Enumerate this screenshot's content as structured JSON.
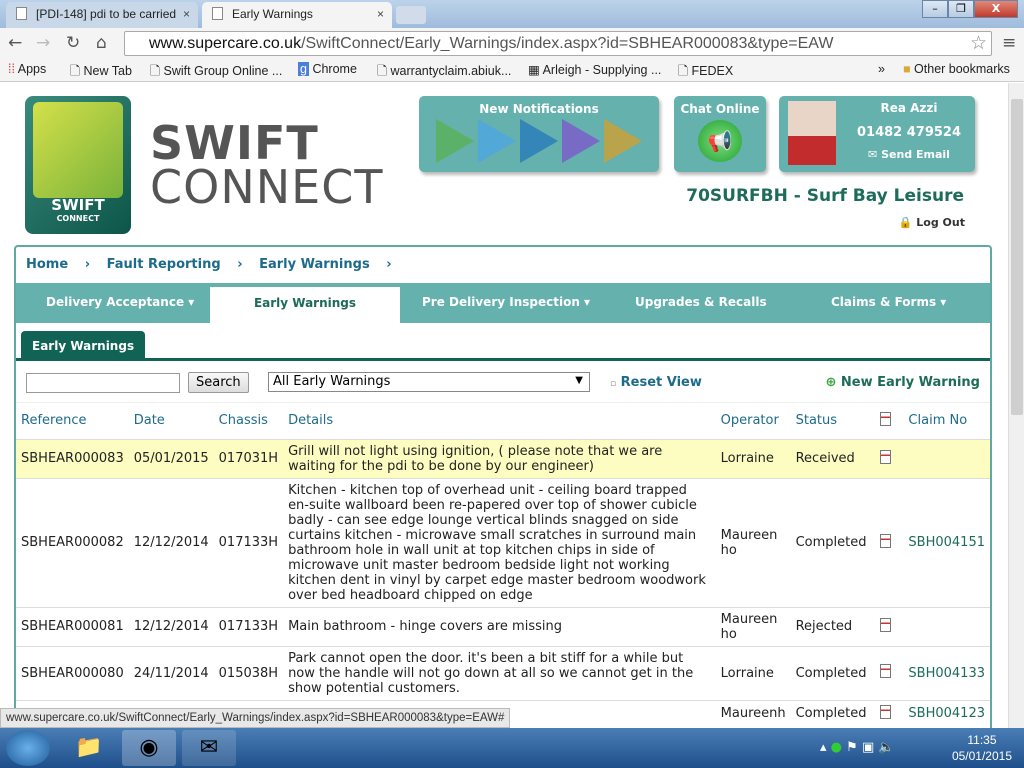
{
  "browser": {
    "tabs": [
      {
        "label": "[PDI-148] pdi to be carried"
      },
      {
        "label": "Early Warnings"
      }
    ],
    "url_host": "www.supercare.co.uk",
    "url_path": "/SwiftConnect/Early_Warnings/index.aspx?id=SBHEAR000083&type=EAW",
    "bookmarks": [
      "Apps",
      "New Tab",
      "Swift Group Online ...",
      "Chrome",
      "warrantyclaim.abiuk...",
      "Arleigh - Supplying ...",
      "FEDEX"
    ],
    "overflow": "»",
    "other_bookmarks": "Other bookmarks",
    "status_url": "www.supercare.co.uk/SwiftConnect/Early_Warnings/index.aspx?id=SBHEAR000083&type=EAW#"
  },
  "header": {
    "logo_text": "SWIFT",
    "logo_sub": "CONNECT",
    "brand_line1": "SWIFT",
    "brand_line2": "CONNECT",
    "notifications_title": "New Notifications",
    "notification_icons": [
      "caravan-icon",
      "laptop-icon",
      "truck-icon",
      "gears-icon",
      "tools-icon"
    ],
    "notification_colors": [
      "#5bb25c",
      "#4fa7dd",
      "#2a7fb8",
      "#7b5fc9",
      "#c9a23a"
    ],
    "chat_label": "Chat Online",
    "contact": {
      "name": "Rea Azzi",
      "phone": "01482 479524",
      "email_label": "Send Email"
    },
    "site_name": "70SURFBH - Surf Bay Leisure",
    "logout": "Log Out"
  },
  "breadcrumb": [
    "Home",
    "Fault Reporting",
    "Early Warnings"
  ],
  "nav": [
    {
      "label": "Delivery Acceptance ▾"
    },
    {
      "label": "Early Warnings"
    },
    {
      "label": "Pre Delivery Inspection ▾"
    },
    {
      "label": "Upgrades & Recalls"
    },
    {
      "label": "Claims & Forms ▾"
    }
  ],
  "subtab": "Early Warnings",
  "filters": {
    "search_value": "",
    "search_button": "Search",
    "select_value": "All Early Warnings",
    "reset": "Reset View",
    "new": "New Early Warning"
  },
  "table": {
    "columns": [
      "Reference",
      "Date",
      "Chassis",
      "Details",
      "Operator",
      "Status",
      "",
      "Claim No"
    ],
    "rows": [
      {
        "ref": "SBHEAR000083",
        "date": "05/01/2015",
        "chassis": "017031H",
        "details": "Grill will not light using ignition, ( please note that we are waiting for the pdi to be done by our engineer)",
        "operator": "Lorraine",
        "status": "Received",
        "claim": ""
      },
      {
        "ref": "SBHEAR000082",
        "date": "12/12/2014",
        "chassis": "017133H",
        "details": "Kitchen - kitchen top of overhead unit - ceiling board trapped en-suite wallboard been re-papered over top of shower cubicle badly - can see edge lounge vertical blinds snagged on side curtains kitchen - microwave small scratches in surround main bathroom hole in wall unit at top kitchen chips in side of microwave unit master bedroom bedside light not working kitchen dent in vinyl by carpet edge master bedroom woodwork over bed headboard chipped on edge",
        "operator": "Maureen ho",
        "status": "Completed",
        "claim": "SBH004151"
      },
      {
        "ref": "SBHEAR000081",
        "date": "12/12/2014",
        "chassis": "017133H",
        "details": "Main bathroom - hinge covers are missing",
        "operator": "Maureen ho",
        "status": "Rejected",
        "claim": ""
      },
      {
        "ref": "SBHEAR000080",
        "date": "24/11/2014",
        "chassis": "015038H",
        "details": "Park cannot open the door. it's been a bit stiff for a while but now the handle will not go down at all so we cannot get in the show potential customers.",
        "operator": "Lorraine",
        "status": "Completed",
        "claim": "SBH004133"
      },
      {
        "ref": "",
        "date": "",
        "chassis": "",
        "details": "",
        "operator": "Maureenh",
        "status": "Completed",
        "claim": "SBH004123"
      }
    ]
  },
  "taskbar": {
    "time": "11:35",
    "date": "05/01/2015"
  }
}
